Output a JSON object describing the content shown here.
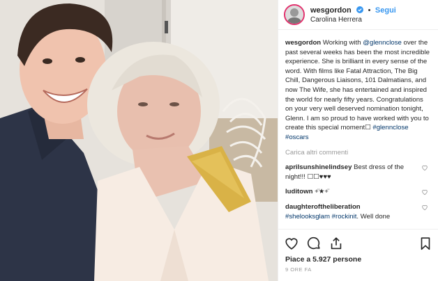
{
  "header": {
    "username": "wesgordon",
    "separator": "•",
    "follow_label": "Segui",
    "location": "Carolina Herrera"
  },
  "post": {
    "author": "wesgordon",
    "caption_1": " Working with ",
    "mention_1": "@glennclose",
    "caption_2": " over the past several weeks has been the most incredible experience. She is brilliant in every sense of the word. With films like Fatal Attraction, The Big Chill, Dangerous Liaisons, 101 Dalmatians, and now The Wife, she has entertained and inspired the world for nearly fifty years. Congratulations on your very well deserved nomination tonight, Glenn. I am so proud to have worked with you to create this special moment☐ ",
    "hashtag_1": "#glennclose",
    "hashtag_2": "#oscars"
  },
  "load_more_comments": "Carica altri commenti",
  "comments": [
    {
      "user": "aprilsunshinelindsey",
      "text": " Best dress of the night!!! ☐☐♥♥♥"
    },
    {
      "user": "luditown",
      "text": " +̈★+̈"
    },
    {
      "user": "daughteroftheliberation",
      "hashtag_1": "#shelooksglam",
      "hashtag_2": "#rockinit",
      "text": ". Well done"
    }
  ],
  "likes": "Piace a 5.927 persone",
  "timestamp": "9 ORE FA",
  "icons": {
    "like": "heart-icon",
    "comment": "comment-icon",
    "share": "share-icon",
    "save": "bookmark-icon",
    "verified": "verified-badge-icon"
  }
}
